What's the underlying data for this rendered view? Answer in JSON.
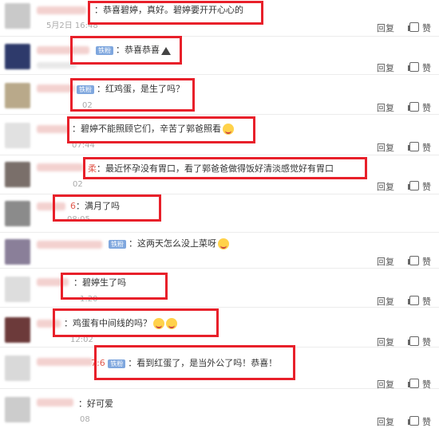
{
  "reply_label": "回复",
  "like_label": "赞",
  "like_icon": "thumbs-up-icon",
  "badge_label": "铁粉",
  "highlight_color": "#e8202a",
  "comments": [
    {
      "text": "：恭喜碧婷，真好。碧婷要开开心心的",
      "time": "5月2日 16:48",
      "avatar": "#c9c9c9"
    },
    {
      "text": "：恭喜恭喜",
      "time": "",
      "avatar": "#2e3a6b"
    },
    {
      "text": "：红鸡蛋，是生了吗？",
      "time": "02",
      "avatar": "#b9a98a"
    },
    {
      "text": "：碧婷不能照顾它们，辛苦了郭爸照看",
      "time": "07:44",
      "avatar": "#e1e1e1"
    },
    {
      "text": "：最近怀孕没有胃口，看了郭爸爸做得饭好清淡感觉好有胃口",
      "time": "02",
      "avatar": "#7a6f6a",
      "frag": "柔"
    },
    {
      "text": "：满月了吗",
      "time": "08:05",
      "avatar": "#8b8b8b",
      "frag": "6"
    },
    {
      "text": "：这两天怎么没上菜呀",
      "time": "",
      "avatar": "#8a7f99"
    },
    {
      "text": "：碧婷生了吗",
      "time": "1:20",
      "avatar": "#ddd"
    },
    {
      "text": "：鸡蛋有中间线的吗？",
      "time": "12:02",
      "avatar": "#6c3a3a"
    },
    {
      "text": "：看到红蛋了，是当外公了吗！恭喜！",
      "time": "",
      "avatar": "#d9d9d9",
      "frag": "7:6"
    },
    {
      "text": "：好可爱",
      "time": "08",
      "avatar": "#cccccc"
    }
  ]
}
